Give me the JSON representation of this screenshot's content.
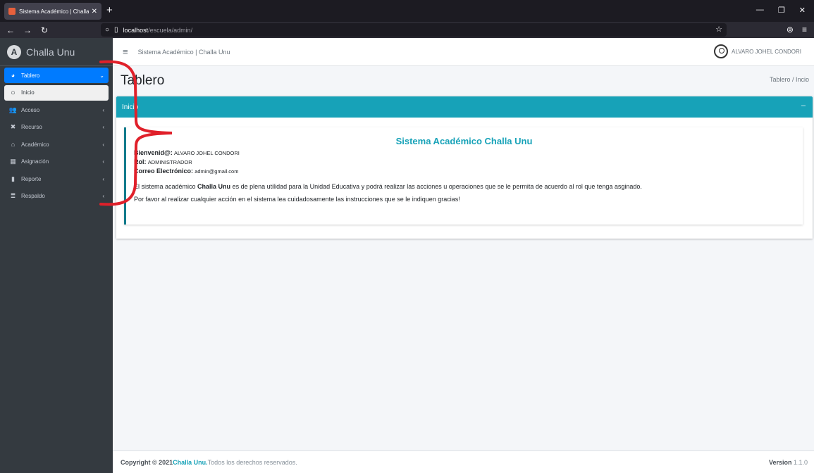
{
  "browser": {
    "tab_title": "Sistema Académico | Challa Un",
    "url_host": "localhost",
    "url_path": "/escuela/admin/"
  },
  "sidebar": {
    "brand": "Challa Unu",
    "items": [
      {
        "label": "Tablero",
        "icon": "dashboard-icon"
      },
      {
        "label": "Inicio",
        "icon": "circle-icon"
      },
      {
        "label": "Acceso",
        "icon": "users-icon"
      },
      {
        "label": "Recurso",
        "icon": "tools-icon"
      },
      {
        "label": "Académico",
        "icon": "school-icon"
      },
      {
        "label": "Asignación",
        "icon": "sitemap-icon"
      },
      {
        "label": "Reporte",
        "icon": "file-icon"
      },
      {
        "label": "Respaldo",
        "icon": "database-icon"
      }
    ]
  },
  "topbar": {
    "title": "Sistema Académico | Challa Unu",
    "user": "ALVARO JOHEL CONDORI"
  },
  "content": {
    "page_title": "Tablero",
    "breadcrumb": "Tablero / Incio",
    "card_title": "Inicio",
    "card_tool": "–",
    "callout_title": "Sistema Académico Challa Unu",
    "welcome_label": "Bienvenid@:",
    "welcome_value": "ALVARO JOHEL CONDORI",
    "rol_label": "Rol:",
    "rol_value": "ADMINISTRADOR",
    "email_label": "Correo Electrónico:",
    "email_value": "admin@gmail.com",
    "para1_pre": "El sistema académico ",
    "para1_bold": "Challa Unu",
    "para1_post": " es de plena utilidad para la Unidad Educativa y podrá realizar las acciones u operaciones que se le permita de acuerdo al rol que tenga asginado.",
    "para2": "Por favor al realizar cualquier acción en el sistema lea cuidadosamente las instrucciones que se le indiquen gracias!"
  },
  "footer": {
    "copyright": "Copyright © 2021 ",
    "brand": "Challa Unu.",
    "rights": " Todos los derechos reservados.",
    "version_label": "Version",
    "version_value": " 1.1.0"
  },
  "colors": {
    "accent": "#17a2b8",
    "active": "#007bff",
    "sidebar": "#343a40",
    "annotation": "#e0202a"
  }
}
